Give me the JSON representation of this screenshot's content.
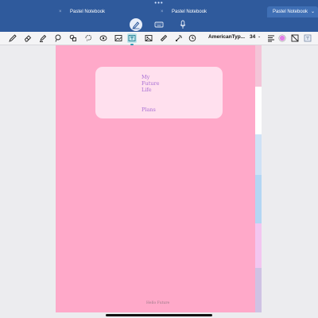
{
  "tabs": [
    {
      "label": "Pastel Notebook",
      "active": false,
      "close": "×"
    },
    {
      "label": "Pastel Notebook",
      "active": false,
      "close": "×"
    },
    {
      "label": "Pastel Notebook",
      "active": true,
      "close": "×",
      "chevron": "⌄"
    }
  ],
  "window_dots": "•••",
  "mode_bar": {
    "items": [
      {
        "icon": "pencil-circle-icon",
        "active": true
      },
      {
        "icon": "keyboard-icon",
        "active": false
      },
      {
        "icon": "microphone-icon",
        "active": false
      }
    ]
  },
  "toolbar": {
    "tools": [
      "pen-icon",
      "eraser-icon",
      "highlighter-icon",
      "lasso-icon",
      "shapes-icon",
      "lasso-loop-icon",
      "sticker-icon",
      "image-icon",
      "text-tool-icon",
      "photo-icon",
      "ruler-icon",
      "laser-pointer-icon",
      "clock-icon"
    ],
    "selected_tool": "text-tool-icon",
    "font_name": "AmericanTyp...",
    "font_size": "34",
    "font_size_chevron": "⌄",
    "text_color": "#e37ee6"
  },
  "page": {
    "background": "#ffa9c9",
    "title_box_color": "#ffe0ee",
    "title_lines": [
      "My",
      "Future",
      "Life"
    ],
    "subtitle": "Plans",
    "footer": "Hello Future",
    "divider_tabs": [
      {
        "color": "#f4c4d8"
      },
      {
        "color": "#ffffff"
      },
      {
        "color": "#cfe2f6"
      },
      {
        "color": "#b3d6f4"
      },
      {
        "color": "#f3c6f0"
      },
      {
        "color": "#cfc2e4"
      }
    ]
  }
}
